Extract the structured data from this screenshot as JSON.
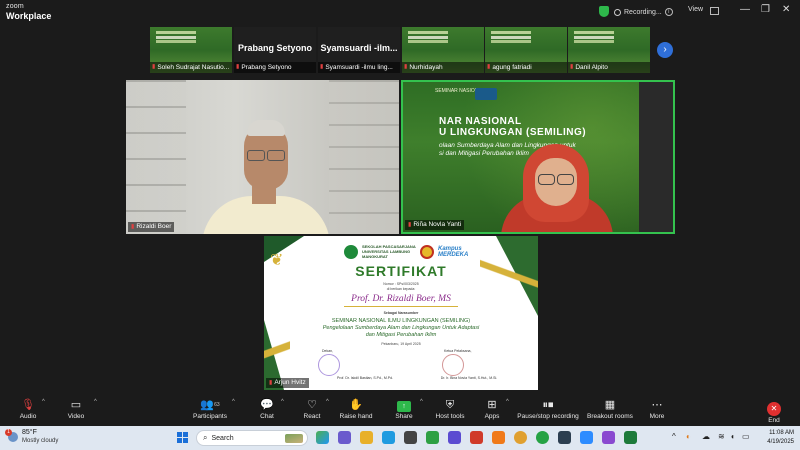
{
  "titlebar": {
    "brand_line1": "zoom",
    "brand_line2": "Workplace",
    "recording_label": "Recording...",
    "view_label": "View",
    "minimize": "—",
    "maximize": "❐",
    "close": "✕"
  },
  "gallery": [
    {
      "name": "Soleh Sudrajat Nasutio...",
      "type": "video"
    },
    {
      "name": "Prabang Setyono",
      "type": "name",
      "display": "Prabang Setyono"
    },
    {
      "name": "Syamsuardi -ilmu ling...",
      "type": "name",
      "display": "Syamsuardi -ilm..."
    },
    {
      "name": "Nurhidayah",
      "type": "video"
    },
    {
      "name": "agung fatriadi",
      "type": "video"
    },
    {
      "name": "Danil Alpito",
      "type": "video"
    }
  ],
  "tiles": {
    "speaker1_name": "Rizaldi Boer",
    "speaker2_name": "Riña Novla Yanti",
    "speaker3_name": "Arjun Hvitz",
    "slide_header": "SEMINAR NASIONAL",
    "slide_title": "NAR NASIONAL",
    "slide_title2": "U LINGKUNGAN (SEMILING)",
    "slide_sub1": "olaan Sumberdaya Alam dan Lingkungan untuk",
    "slide_sub2": "si dan Mitigasi Perubahan Iklim"
  },
  "certificate": {
    "school_line1": "SEKOLAH PASCASARJANA",
    "school_line2": "UNIVERSITAS LAMBUNG MANGKURAT",
    "kampus": "Kampus",
    "merdeka": "MERDEKA",
    "title": "SERTIFIKAT",
    "number": "Nomor : SPs/003/2025",
    "given_to": "di berikan kepada:",
    "recipient": "Prof. Dr. Rizaldi Boer,  MS",
    "role": "Sebagai Narasumber",
    "event_line1": "SEMINAR NASIONAL ILMU LINGKUNGAN (SEMILING)",
    "event_line2": "Pengelolaan Sumberdaya Alam dan Lingkungan Untuk Adaptasi",
    "event_line3": "dan Mitigasi Perubahan Iklim",
    "date": "Pekanbaru, 19 April 2025",
    "sig_left_title": "Dekan,",
    "sig_left_name": "Prof. Dr. Iskdil Bastian, S.Pd., M.Pd.",
    "sig_right_title": "Ketua Pelaksana,",
    "sig_right_name": "Dr. Ir. Bina Novia Yanti, S.Hut., M.Si."
  },
  "toolbar": {
    "audio": "Audio",
    "video": "Video",
    "participants": "Participants",
    "participants_count": "63",
    "chat": "Chat",
    "react": "React",
    "raise_hand": "Raise hand",
    "share": "Share",
    "host_tools": "Host tools",
    "apps": "Apps",
    "pause_stop": "Pause/stop recording",
    "breakout": "Breakout rooms",
    "more": "More",
    "end": "End"
  },
  "taskbar": {
    "weather_temp": "85°F",
    "weather_desc": "Mostly cloudy",
    "weather_badge": "1",
    "search_placeholder": "Search",
    "time": "11:08 AM",
    "date": "4/19/2025"
  },
  "colors": {
    "active_speaker_border": "#34c24e",
    "end_red": "#e03030",
    "share_green": "#2eb84b",
    "next_arrow_blue": "#2f6fd8"
  }
}
